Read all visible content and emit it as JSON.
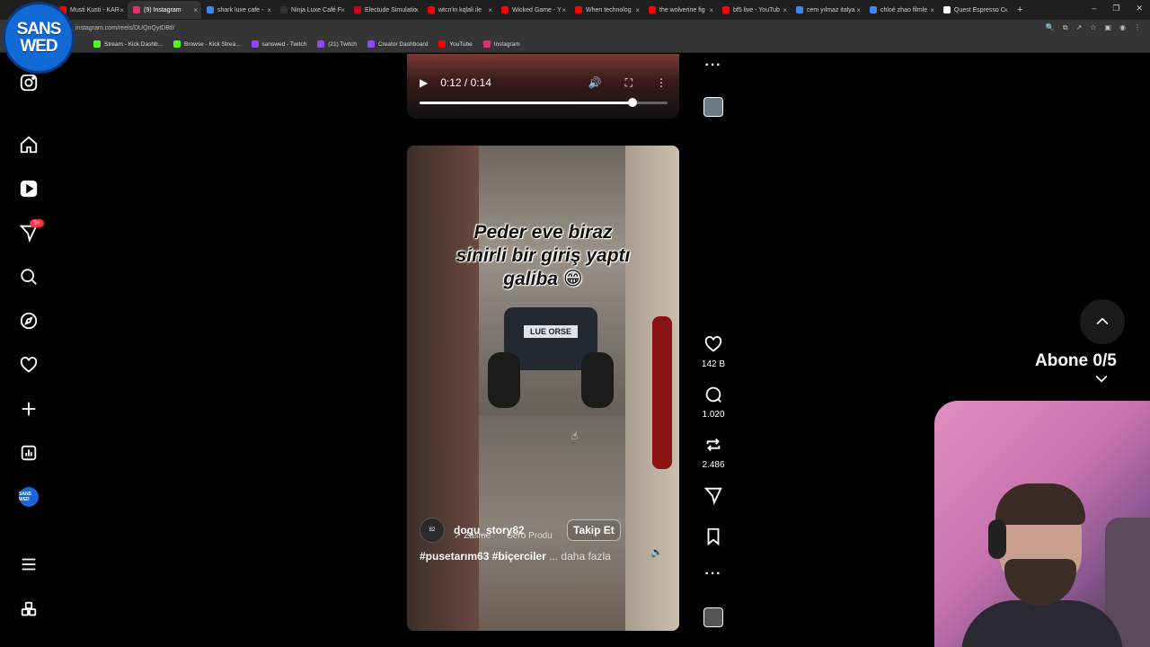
{
  "browser": {
    "tabs": [
      {
        "label": "Musti Kusti - KAR",
        "color": "#ff0000"
      },
      {
        "label": "(9) Instagram",
        "color": "#e1306c",
        "active": true
      },
      {
        "label": "shark luxe cafe -",
        "color": "#4285f4"
      },
      {
        "label": "Ninja Luxe Café F",
        "color": "#333333"
      },
      {
        "label": "Electude Simulatio",
        "color": "#d0021b"
      },
      {
        "label": "wtcn'in kqlali ile",
        "color": "#ff0000"
      },
      {
        "label": "Wicked Game - Y",
        "color": "#ff0000"
      },
      {
        "label": "When technolog",
        "color": "#ff0000"
      },
      {
        "label": "the wolverine fig",
        "color": "#ff0000"
      },
      {
        "label": "bf5 live - YouTub",
        "color": "#ff0000"
      },
      {
        "label": "cem yılmaz italya",
        "color": "#4285f4"
      },
      {
        "label": "chloé zhao filmle",
        "color": "#4285f4"
      },
      {
        "label": "Quest Espresso C",
        "color": "#ffffff"
      }
    ],
    "url": "instagram.com/reels/DUQnQytDBtl/",
    "bookmarks": [
      {
        "label": "Stream - Kick Dashb...",
        "color": "#53fc18"
      },
      {
        "label": "Browse - Kick Strea...",
        "color": "#53fc18"
      },
      {
        "label": "sanswed - Twitch",
        "color": "#9146ff"
      },
      {
        "label": "(21) Twitch",
        "color": "#9146ff"
      },
      {
        "label": "Creator Dashboard",
        "color": "#9146ff"
      },
      {
        "label": "YouTube",
        "color": "#ff0000"
      },
      {
        "label": "Instagram",
        "color": "#e1306c"
      }
    ]
  },
  "overlay_logo": {
    "line1": "SANS",
    "line2": "WED"
  },
  "sidebar": {
    "items": [
      "instagram-logo",
      "home",
      "reels",
      "messages",
      "search",
      "explore",
      "notifications",
      "create",
      "dashboard",
      "profile",
      "more",
      "also-from-meta"
    ],
    "notification_badge": "9+",
    "profile_label": "SANS WED"
  },
  "video_prev": {
    "time": "0:12 / 0:14",
    "progress": 0.86
  },
  "reel": {
    "caption_line1": "Peder eve biraz",
    "caption_line2": "sinirli bir giriş yaptı",
    "caption_line3": "galiba 😁",
    "plate_text": "LUE ORSE",
    "username": "dogu_story82",
    "audio_artist": "↗ Zalime",
    "audio_producer": "Sero Produ",
    "follow_label": "Takip Et",
    "hashtags": "#pusetarım63 #biçerciler",
    "more_label": "... daha fazla",
    "avatar_text": "82"
  },
  "actions": {
    "likes": "142 B",
    "comments": "1.020",
    "reposts": "2.486"
  },
  "subscription_overlay": {
    "label": "Abone 0/5"
  }
}
